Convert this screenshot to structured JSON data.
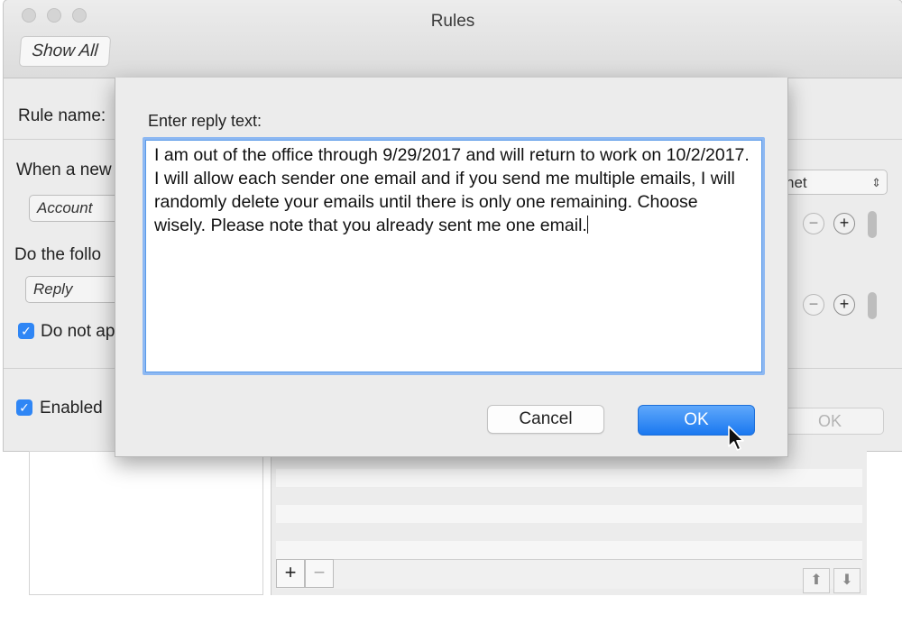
{
  "window": {
    "title": "Rules",
    "show_all_label": "Show All"
  },
  "background": {
    "rule_name_label": "Rule name:",
    "when_label": "When a new",
    "condition_popup": "Account",
    "condition_value_fragment": "net",
    "do_following_label": "Do the follo",
    "action_popup": "Reply",
    "do_not_apply_label": "Do not ap",
    "enabled_label": "Enabled",
    "ok_label": "OK",
    "remove_symbol": "−",
    "add_symbol": "+",
    "up_symbol": "⬆",
    "down_symbol": "⬇"
  },
  "dialog": {
    "prompt": "Enter reply text:",
    "reply_text": "I am out of the office through 9/29/2017 and will return to work on 10/2/2017. I will allow each sender one email and if you send me multiple emails, I will randomly delete your emails until there is only one remaining. Choose wisely. Please note that you already sent me one email.",
    "cancel_label": "Cancel",
    "ok_label": "OK"
  },
  "colors": {
    "accent": "#2f86f5",
    "window_bg": "#ececec",
    "focus_ring": "#8db8f2"
  }
}
